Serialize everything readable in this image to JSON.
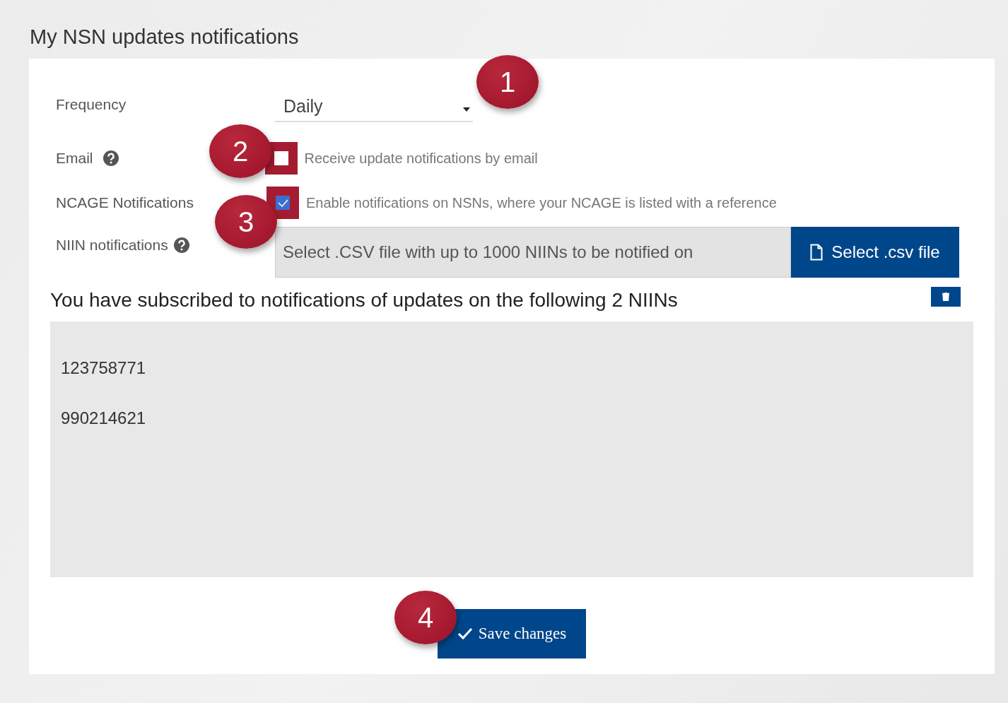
{
  "title": "My NSN updates notifications",
  "frequency": {
    "label": "Frequency",
    "value": "Daily"
  },
  "email": {
    "label": "Email",
    "checked": false,
    "text": "Receive update notifications by email"
  },
  "ncage": {
    "label": "NCAGE Notifications",
    "checked": true,
    "text": "Enable notifications on NSNs, where your NCAGE is listed with a reference"
  },
  "niin": {
    "label": "NIIN notifications",
    "placeholder": "Select .CSV file with up to 1000 NIINs to be notified on",
    "button": "Select .csv file"
  },
  "subscribed": {
    "heading": "You have subscribed to notifications of updates on the following 2 NIINs",
    "items": [
      "123758771",
      "990214621"
    ]
  },
  "save_button": "Save changes",
  "callouts": [
    "1",
    "2",
    "3",
    "4"
  ]
}
